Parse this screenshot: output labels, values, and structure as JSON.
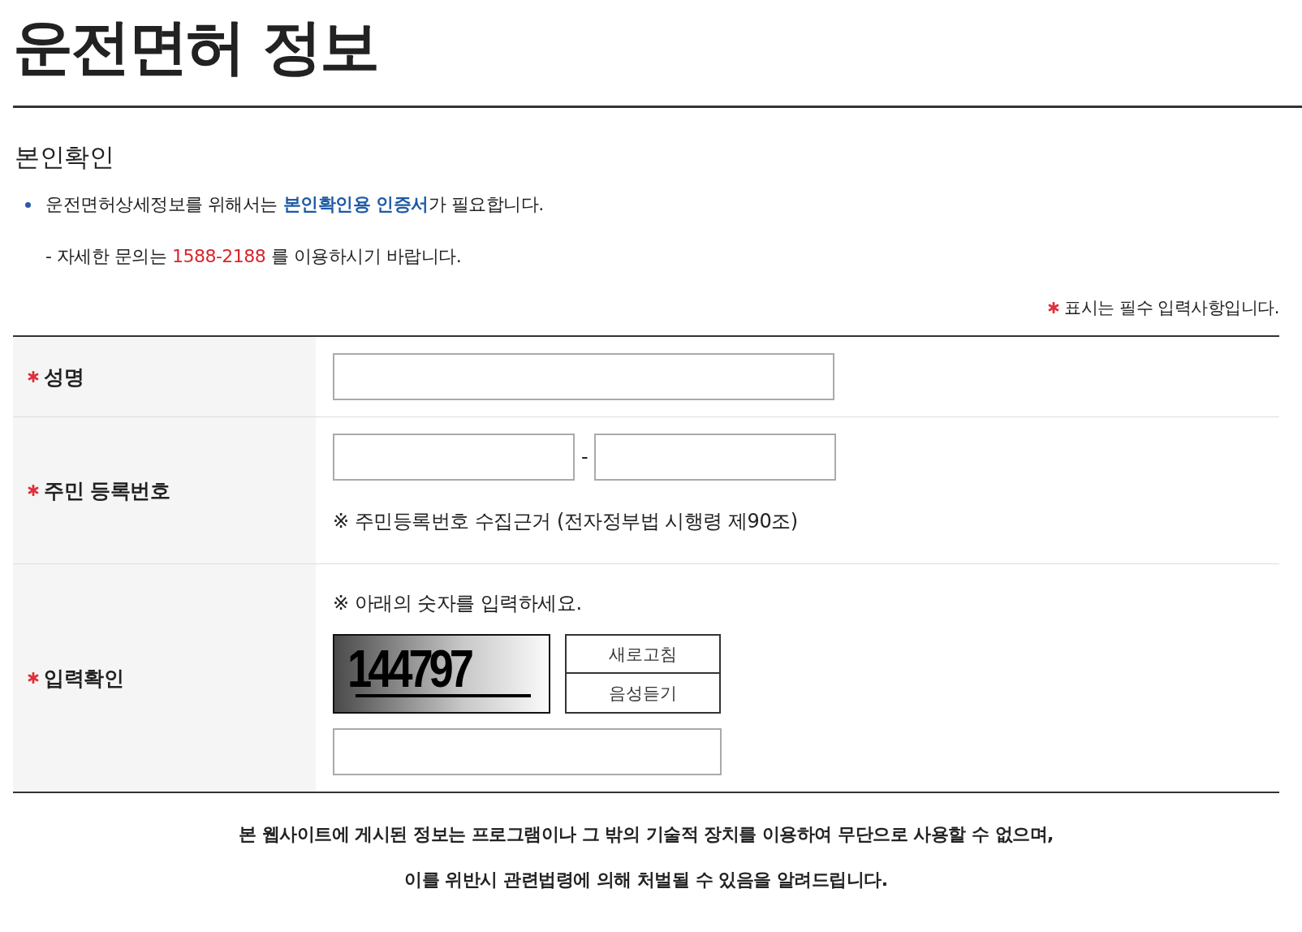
{
  "page_title": "운전면허 정보",
  "section_title": "본인확인",
  "notice": {
    "before": "운전면허상세정보를 위해서는 ",
    "highlight": "본인확인용 인증서",
    "after": "가 필요합니다."
  },
  "contact": {
    "before": "- 자세한 문의는 ",
    "phone": "1588-2188",
    "after": " 를 이용하시기 바랍니다."
  },
  "required_note": {
    "text": "표시는 필수 입력사항입니다."
  },
  "rows": [
    {
      "kind": "text",
      "label": "성명",
      "required": true
    },
    {
      "kind": "rrn",
      "label": "주민 등록번호",
      "required": true,
      "separator": "-",
      "note": "※ 주민등록번호 수집근거 (전자정부법 시행령 제90조)"
    },
    {
      "kind": "captcha",
      "label": "입력확인",
      "required": true,
      "note": "※ 아래의 숫자를 입력하세요.",
      "captcha": "144797",
      "buttons": [
        "새로고침",
        "음성듣기"
      ]
    }
  ],
  "footer": [
    "본 웹사이트에 게시된 정보는 프로그램이나 그 밖의 기술적 장치를 이용하여 무단으로 사용할 수 없으며,",
    "이를 위반시 관련법령에 의해 처벌될 수 있음을 알려드립니다."
  ]
}
